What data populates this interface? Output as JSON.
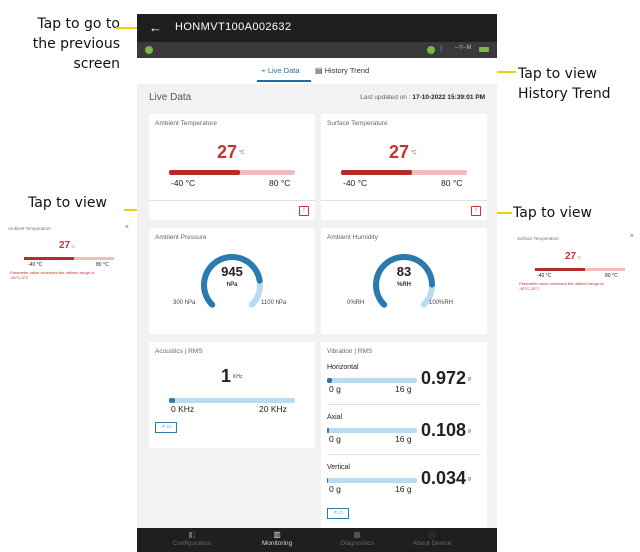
{
  "annotations": {
    "back_l1": "Tap to go to",
    "back_l2": "the previous",
    "back_l3": "screen",
    "history_l1": "Tap to view",
    "history_l2": "History Trend",
    "view_left": "Tap to view",
    "view_right": "Tap to view"
  },
  "header": {
    "back_glyph": "←",
    "title": "HONMVT100A002632"
  },
  "status": {
    "signal_text": "--Y--M"
  },
  "tabs": [
    {
      "icon": "⌁",
      "label": "Live Data"
    },
    {
      "icon": "▤",
      "label": "History Trend"
    }
  ],
  "live": {
    "title": "Live Data",
    "updated_label": "Last updated on :",
    "updated_value": "17-10-2022 15:39:01 PM"
  },
  "cards": {
    "ambient_temp": {
      "title": "Ambient Temperature",
      "value": "27",
      "unit": "°C",
      "min": "-40 °C",
      "max": "80 °C",
      "fraction": 0.56
    },
    "surface_temp": {
      "title": "Surface Temperature",
      "value": "27",
      "unit": "°C",
      "min": "-40 °C",
      "max": "80 °C",
      "fraction": 0.56
    },
    "ambient_pressure": {
      "title": "Ambient Pressure",
      "value": "945",
      "unit": "hPa",
      "min": "300 hPa",
      "max": "1100 hPa",
      "fraction": 0.8
    },
    "ambient_humidity": {
      "title": "Ambient Humidity",
      "value": "83",
      "unit": "%RH",
      "min": "0%RH",
      "max": "100%RH",
      "fraction": 0.83
    },
    "acoustics": {
      "title": "Acoustics | RMS",
      "value": "1",
      "unit": "KHz",
      "min": "0 KHz",
      "max": "20 KHz",
      "fraction": 0.05,
      "trend_label": "↗ ▭"
    },
    "vibration": {
      "title": "Vibration | RMS",
      "trend_label": "↗ ▭",
      "axes": [
        {
          "label": "Horizontal",
          "value": "0.972",
          "unit": "g",
          "min": "0 g",
          "max": "16 g",
          "fraction": 0.06
        },
        {
          "label": "Axial",
          "value": "0.108",
          "unit": "g",
          "min": "0 g",
          "max": "16 g",
          "fraction": 0.02
        },
        {
          "label": "Vertical",
          "value": "0.034",
          "unit": "g",
          "min": "0 g",
          "max": "16 g",
          "fraction": 0.01
        }
      ]
    }
  },
  "info_glyph": "!",
  "nav": [
    {
      "icon": "◧",
      "label": "Configuration"
    },
    {
      "icon": "▥",
      "label": "Monitoring"
    },
    {
      "icon": "▦",
      "label": "Diagnostics"
    },
    {
      "icon": "ⓘ",
      "label": "About Device"
    }
  ],
  "popups": {
    "left": {
      "title": "Ambient Temperature",
      "close": "×",
      "value": "27",
      "unit": "°C",
      "min": "-40 °C",
      "max": "80 °C",
      "fraction": 0.56,
      "message": "Parameter value exceeded the defined range of -40°C-0°C"
    },
    "right": {
      "title": "Surface Temperature",
      "close": "×",
      "value": "27",
      "unit": "°C",
      "min": "-40 °C",
      "max": "80 °C",
      "fraction": 0.56,
      "message": "Parameter value exceeded the defined range of -40°C-20°C"
    }
  },
  "colors": {
    "accent_blue": "#2a7ab0",
    "alert_red": "#c43434",
    "annotation_yellow": "#f0d000"
  }
}
